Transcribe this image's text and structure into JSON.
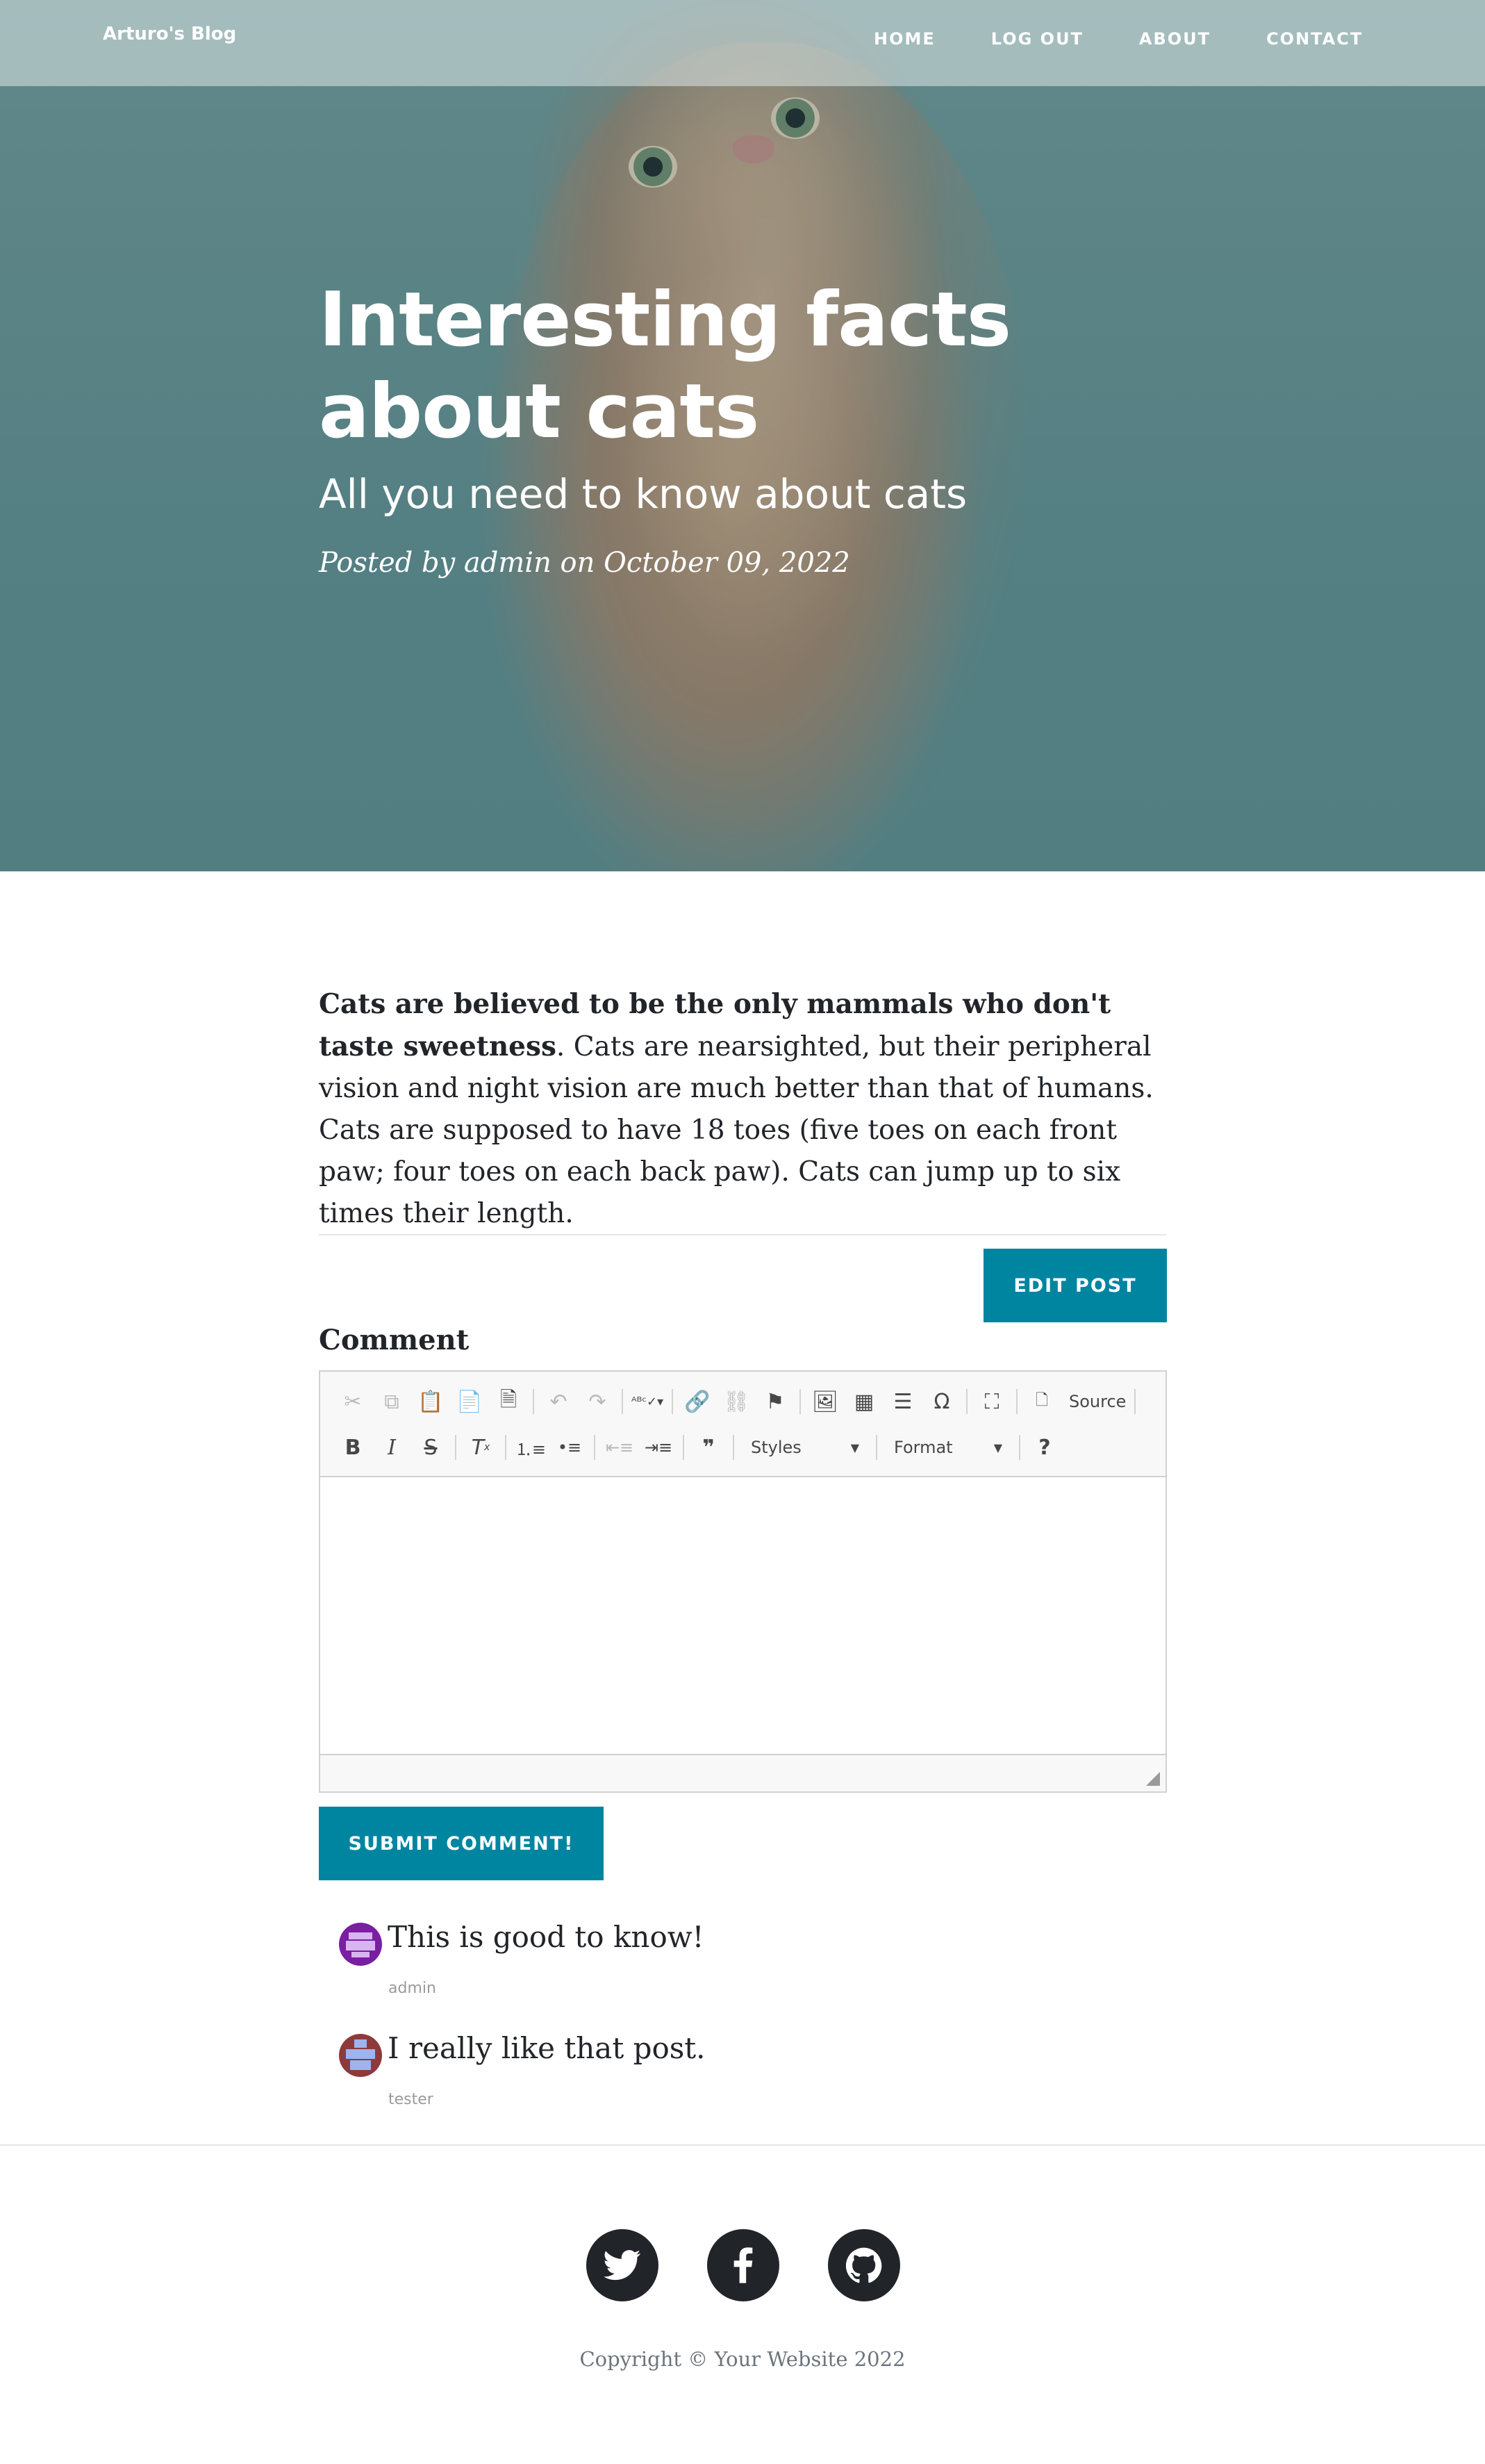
{
  "nav": {
    "brand": "Arturo's Blog",
    "links": [
      "HOME",
      "LOG OUT",
      "ABOUT",
      "CONTACT"
    ]
  },
  "hero": {
    "title": "Interesting facts about cats",
    "subtitle": "All you need to know about cats",
    "meta_prefix": "Posted by",
    "author": "admin",
    "meta_on": "on",
    "date": "October 09, 2022"
  },
  "article": {
    "bold": "Cats are believed to be the only mammals who don't taste sweetness",
    "body": ". Cats are nearsighted, but their peripheral vision and night vision are much better than that of humans. Cats are supposed to have 18 toes (five toes on each front paw; four toes on each back paw). Cats can jump up to six times their length."
  },
  "actions": {
    "edit_label": "EDIT POST",
    "submit_label": "SUBMIT COMMENT!"
  },
  "comment_form": {
    "label": "Comment",
    "toolbar": {
      "source_label": "Source",
      "styles_label": "Styles",
      "format_label": "Format"
    }
  },
  "comments": [
    {
      "text": "This is good to know!",
      "author": "admin"
    },
    {
      "text": "I really like that post.",
      "author": "tester"
    }
  ],
  "footer": {
    "social": [
      "twitter-icon",
      "facebook-icon",
      "github-icon"
    ],
    "copyright": "Copyright © Your Website 2022"
  },
  "colors": {
    "accent": "#0085a1",
    "footer_icon_bg": "#212529",
    "text": "#212529",
    "muted": "#6c757d"
  }
}
